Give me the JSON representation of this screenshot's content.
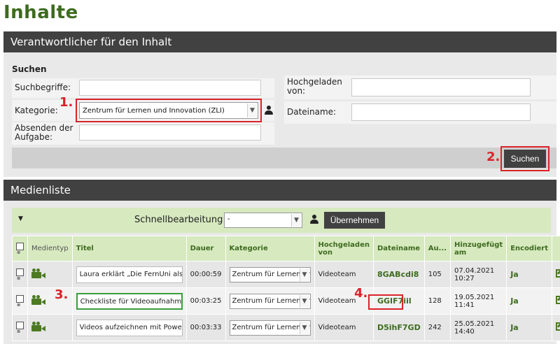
{
  "page_title": "Inhalte",
  "section1": {
    "header": "Verantwortlicher für den Inhalt",
    "search_title": "Suchen",
    "labels": {
      "suchbegriffe": "Suchbegriffe:",
      "kategorie": "Kategorie:",
      "absenden": "Absenden der Aufgabe:",
      "hochgeladen": "Hochgeladen von:",
      "dateiname": "Dateiname:"
    },
    "kategorie_value": "Zentrum für Lernen und Innovation (ZLI)",
    "search_button": "Suchen"
  },
  "section2": {
    "header": "Medienliste",
    "quick_label": "Schnellbearbeitung:",
    "quick_value": "-",
    "apply_button": "Übernehmen",
    "columns": [
      "Medientyp",
      "Titel",
      "Dauer",
      "Kategorie",
      "Hochgeladen von",
      "Dateiname",
      "Au...",
      "Hinzugefügt am",
      "Encodiert"
    ],
    "rows": [
      {
        "title": "Laura erklärt „Die FernUni als Ausbildu",
        "duration": "00:00:59",
        "category": "Zentrum für Lernen und",
        "uploader": "Videoteam",
        "file": "8GABcdi8",
        "au": "105",
        "date": "07.04.2021",
        "time": "10:27",
        "encoded": "Ja"
      },
      {
        "title": "Checkliste für Videoaufnahmen im Stu",
        "duration": "00:03:25",
        "category": "Zentrum für Lernen und",
        "uploader": "Videoteam",
        "file": "GGIF7iil",
        "au": "128",
        "date": "19.05.2021",
        "time": "11:41",
        "encoded": "Ja"
      },
      {
        "title": "Videos aufzeichnen mit Powerpoint (\"",
        "duration": "00:03:33",
        "category": "Zentrum für Lernen und",
        "uploader": "Videoteam",
        "file": "D5ihF7GD",
        "au": "242",
        "date": "25.05.2021",
        "time": "14:40",
        "encoded": "Ja"
      }
    ]
  },
  "annotations": [
    "1.",
    "2.",
    "3.",
    "4."
  ],
  "colors": {
    "accent_green": "#3d6b1f",
    "header_dark": "#414141",
    "highlight_red": "#d9232a",
    "light_green": "#d7e9bf"
  }
}
